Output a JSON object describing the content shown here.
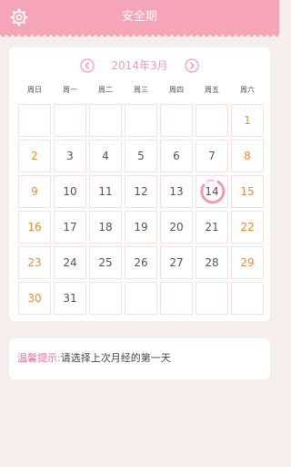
{
  "header": {
    "title": "安全期",
    "settings_icon": "gear-icon",
    "color": "#f6a4b7"
  },
  "calendar": {
    "month_label": "2014年3月",
    "prev_icon": "chevron-left-icon",
    "next_icon": "chevron-right-icon",
    "weekdays": [
      "周日",
      "周一",
      "周二",
      "周三",
      "周四",
      "周五",
      "周六"
    ],
    "selected_day": "14",
    "weeks": [
      [
        "",
        "",
        "",
        "",
        "",
        "",
        "1"
      ],
      [
        "2",
        "3",
        "4",
        "5",
        "6",
        "7",
        "8"
      ],
      [
        "9",
        "10",
        "11",
        "12",
        "13",
        "14",
        "15"
      ],
      [
        "16",
        "17",
        "18",
        "19",
        "20",
        "21",
        "22"
      ],
      [
        "23",
        "24",
        "25",
        "26",
        "27",
        "28",
        "29"
      ],
      [
        "30",
        "31",
        "",
        "",
        "",
        "",
        ""
      ]
    ],
    "weekend_color": "#f08c2c",
    "accent_color": "#f39ab3"
  },
  "tip": {
    "label": "温馨提示:",
    "text": "请选择上次月经的第一天"
  }
}
